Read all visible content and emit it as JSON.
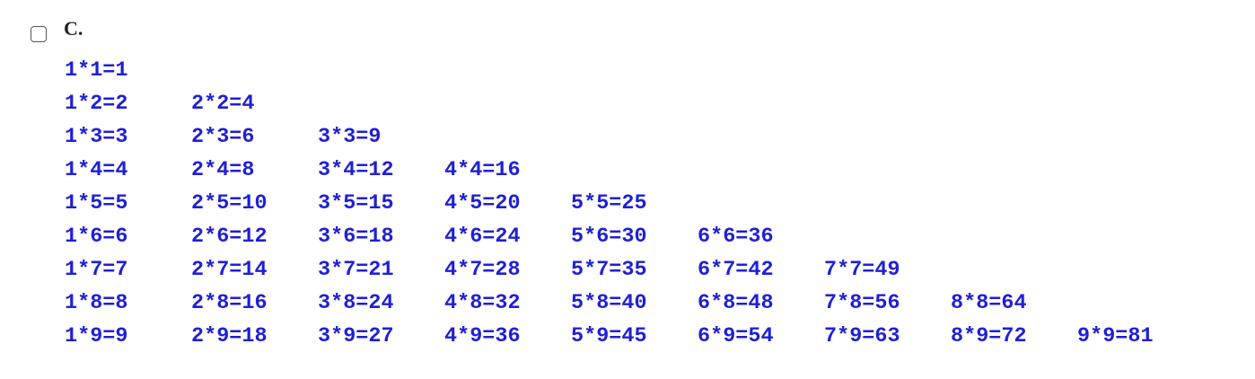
{
  "option": {
    "letter": "C."
  },
  "code_lines": [
    [
      "1*1=1"
    ],
    [
      "1*2=2",
      "2*2=4"
    ],
    [
      "1*3=3",
      "2*3=6",
      "3*3=9"
    ],
    [
      "1*4=4",
      "2*4=8",
      "3*4=12",
      "4*4=16"
    ],
    [
      "1*5=5",
      "2*5=10",
      "3*5=15",
      "4*5=20",
      "5*5=25"
    ],
    [
      "1*6=6",
      "2*6=12",
      "3*6=18",
      "4*6=24",
      "5*6=30",
      "6*6=36"
    ],
    [
      "1*7=7",
      "2*7=14",
      "3*7=21",
      "4*7=28",
      "5*7=35",
      "6*7=42",
      "7*7=49"
    ],
    [
      "1*8=8",
      "2*8=16",
      "3*8=24",
      "4*8=32",
      "5*8=40",
      "6*8=48",
      "7*8=56",
      "8*8=64"
    ],
    [
      "1*9=9",
      "2*9=18",
      "3*9=27",
      "4*9=36",
      "5*9=45",
      "6*9=54",
      "7*9=63",
      "8*9=72",
      "9*9=81"
    ]
  ],
  "colors": {
    "code_text": "#1f1fd6",
    "letter_text": "#222222",
    "checkbox_border": "#555555"
  }
}
